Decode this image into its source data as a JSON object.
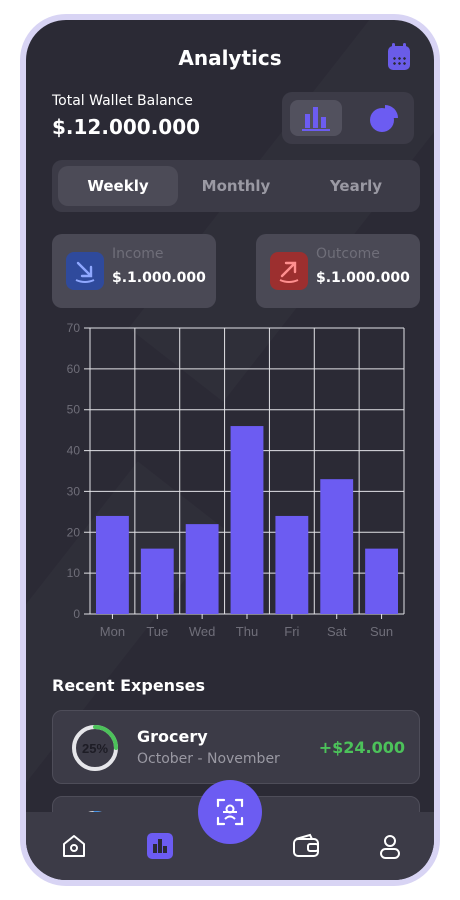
{
  "header": {
    "title": "Analytics",
    "calendar_icon": "calendar-icon"
  },
  "wallet": {
    "label": "Total Wallet Balance",
    "value": "$.12.000.000"
  },
  "view_toggle": {
    "options": [
      "bar-chart-icon",
      "pie-chart-icon"
    ],
    "selected": "bar-chart-icon"
  },
  "period_tabs": {
    "items": [
      "Weekly",
      "Monthly",
      "Yearly"
    ],
    "selected": "Weekly"
  },
  "income": {
    "label": "Income",
    "value": "$.1.000.000",
    "icon": "arrow-down-right-icon",
    "color": "#3b62d8"
  },
  "outcome": {
    "label": "Outcome",
    "value": "$.1.000.000",
    "icon": "arrow-up-right-icon",
    "color": "#d83b3b"
  },
  "chart_data": {
    "type": "bar",
    "categories": [
      "Mon",
      "Tue",
      "Wed",
      "Thu",
      "Fri",
      "Sat",
      "Sun"
    ],
    "values": [
      24,
      16,
      22,
      46,
      24,
      33,
      16
    ],
    "ylim": [
      0,
      70
    ],
    "yticks": [
      0,
      10,
      20,
      30,
      40,
      50,
      60,
      70
    ],
    "grid": true,
    "bar_color": "#6c5cf2"
  },
  "recent_expenses": {
    "title": "Recent Expenses",
    "items": [
      {
        "name": "Grocery",
        "period": "October - November",
        "amount": "+$24.000",
        "percent_label": "25%",
        "progress": 0.25,
        "ring_color": "#4cc25a"
      },
      {
        "name": "",
        "period": "",
        "amount": "",
        "percent_label": "",
        "progress": 0.3,
        "ring_color": "#3b8fe8"
      }
    ]
  },
  "bottom_nav": {
    "items": [
      "home-icon",
      "analytics-icon",
      "wallet-icon",
      "profile-icon"
    ],
    "active": "analytics-icon",
    "fab_icon": "scan-icon"
  },
  "colors": {
    "background": "#2b2a35",
    "card": "#3c3b47",
    "accent": "#6c5cf2",
    "positive": "#4cc25a"
  }
}
